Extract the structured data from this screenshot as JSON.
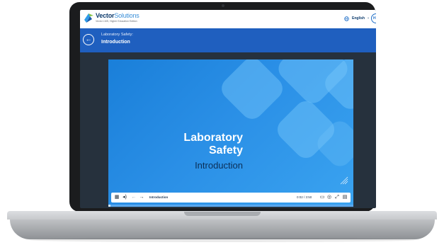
{
  "header": {
    "brand_name": "Vector",
    "brand_name_thin": "Solutions",
    "brand_tagline": "Vector LMS, Higher Education Edition",
    "language": "English",
    "avatar_initials": "HE"
  },
  "course": {
    "title": "Laboratory Safety:",
    "section": "Introduction"
  },
  "slide": {
    "title_line1": "Laboratory",
    "title_line2": "Safety",
    "subtitle": "Introduction"
  },
  "player": {
    "chapter": "Introduction",
    "time": "0:02 / 3:50",
    "progress": 0.01
  },
  "icons": {
    "back": "back-arrow-icon",
    "menu": "grid-menu-icon",
    "audio": "audio-icon",
    "prev": "prev-arrow-icon",
    "next": "next-arrow-icon",
    "captions": "captions-icon",
    "language": "globe-icon",
    "fullscreen": "fullscreen-icon",
    "transcript": "transcript-icon"
  },
  "colors": {
    "brand_blue": "#1f5fbf",
    "dark_bg": "#26313d",
    "slide_blue": "#2a8fe6"
  }
}
